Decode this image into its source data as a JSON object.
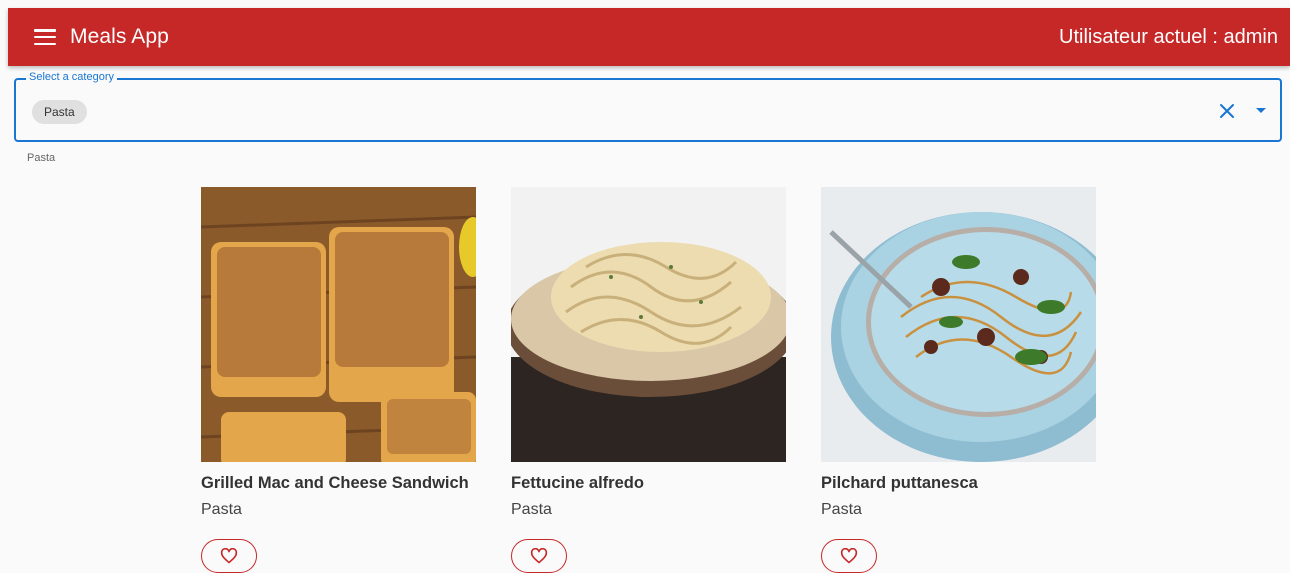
{
  "appbar": {
    "title": "Meals App",
    "user_label": "Utilisateur actuel : admin",
    "color": "#c62828"
  },
  "category_select": {
    "label": "Select a category",
    "selected_chip": "Pasta",
    "helper_text": "Pasta",
    "accent_color": "#1976d2"
  },
  "meals": [
    {
      "title": "Grilled Mac and Cheese Sandwich",
      "category": "Pasta"
    },
    {
      "title": "Fettucine alfredo",
      "category": "Pasta"
    },
    {
      "title": "Pilchard puttanesca",
      "category": "Pasta"
    }
  ],
  "icons": {
    "menu": "menu-icon",
    "clear": "close-icon",
    "dropdown": "arrow-drop-down-icon",
    "favorite": "heart-outline-icon"
  }
}
